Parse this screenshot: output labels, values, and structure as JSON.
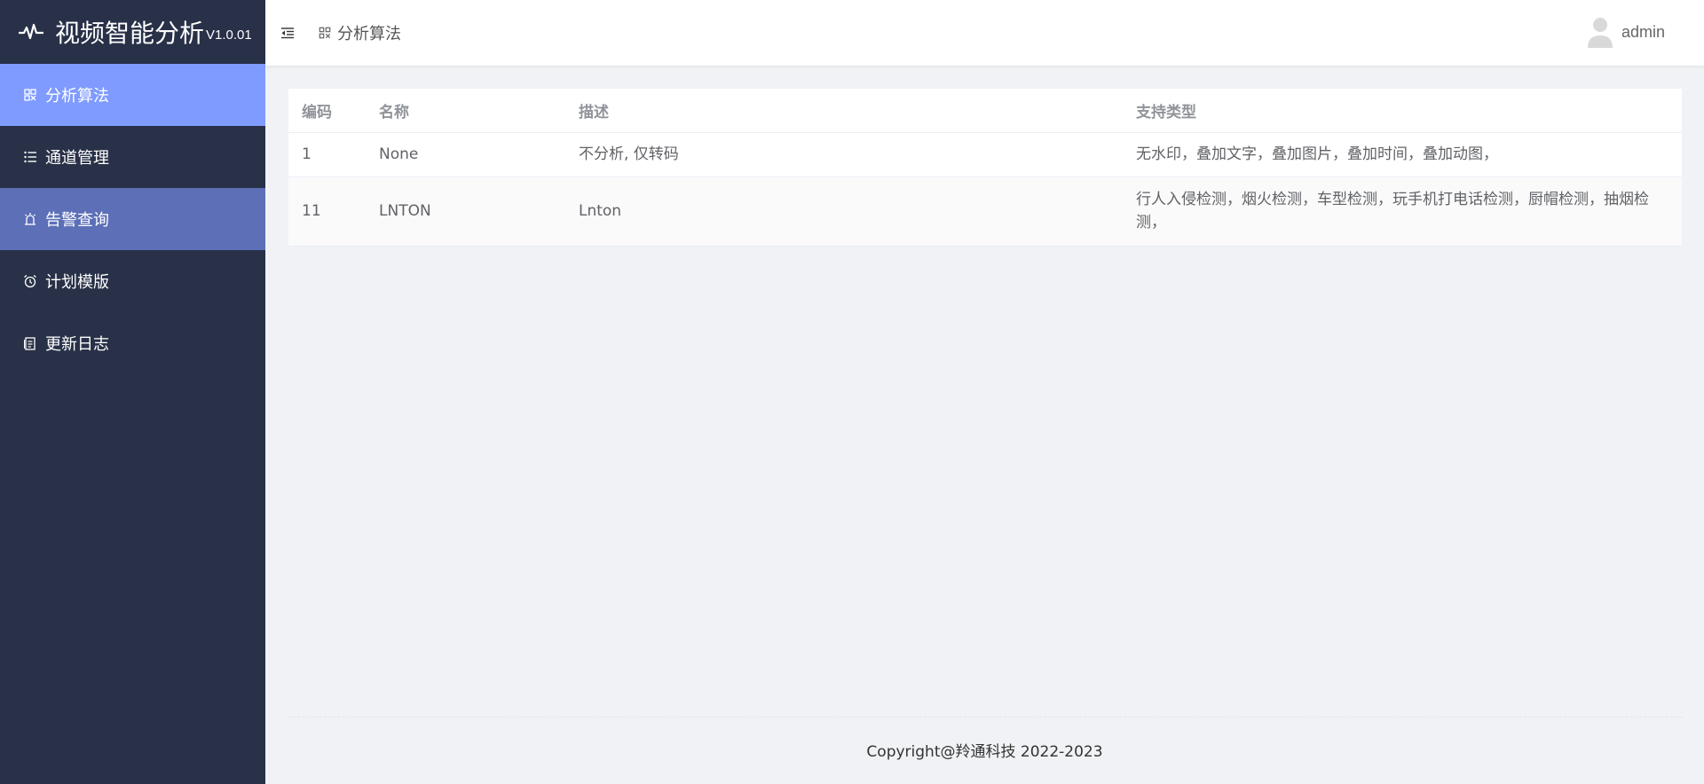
{
  "brand": {
    "title": "视频智能分析",
    "version": "V1.0.01",
    "icon": "pulse-icon"
  },
  "sidebar": {
    "items": [
      {
        "label": "分析算法",
        "icon": "grid-icon",
        "state": "active"
      },
      {
        "label": "通道管理",
        "icon": "list-icon",
        "state": "normal"
      },
      {
        "label": "告警查询",
        "icon": "alarm-icon",
        "state": "hover"
      },
      {
        "label": "计划模版",
        "icon": "clock-icon",
        "state": "normal"
      },
      {
        "label": "更新日志",
        "icon": "document-icon",
        "state": "normal"
      }
    ]
  },
  "header": {
    "breadcrumb": "分析算法",
    "user": "admin"
  },
  "table": {
    "columns": [
      "编码",
      "名称",
      "描述",
      "支持类型"
    ],
    "rows": [
      [
        "1",
        "None",
        "不分析, 仅转码",
        "无水印，叠加文字，叠加图片，叠加时间，叠加动图，"
      ],
      [
        "11",
        "LNTON",
        "Lnton",
        "行人入侵检测，烟火检测，车型检测，玩手机打电话检测，厨帽检测，抽烟检测，"
      ]
    ]
  },
  "footer": {
    "copyright": "Copyright@羚通科技 2022-2023"
  },
  "colors": {
    "sidebar": "#283148",
    "active": "#7f9bff",
    "hover": "#5c6fb7",
    "background": "#f0f2f5"
  }
}
